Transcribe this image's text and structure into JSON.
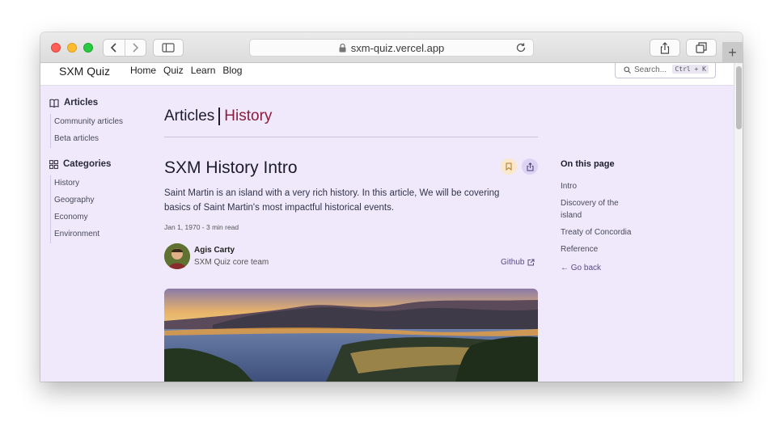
{
  "browser": {
    "url": "sxm-quiz.vercel.app"
  },
  "site": {
    "brand": "SXM Quiz",
    "nav": [
      "Home",
      "Quiz",
      "Learn",
      "Blog"
    ],
    "search": {
      "placeholder": "Search...",
      "shortcut": "Ctrl + K"
    }
  },
  "sidebar": {
    "articles_heading": "Articles",
    "articles_items": [
      "Community articles",
      "Beta articles"
    ],
    "categories_heading": "Categories",
    "categories_items": [
      "History",
      "Geography",
      "Economy",
      "Environment"
    ]
  },
  "breadcrumb": {
    "section": "Articles",
    "category": "History"
  },
  "article": {
    "title": "SXM History Intro",
    "intro": "Saint Martin is an island with a very rich history. In this article, We will be covering basics of Saint Martin's most impactful historical events.",
    "meta": "Jan 1, 1970 - 3 min read",
    "author_name": "Agis Carty",
    "author_role": "SXM Quiz core team",
    "github_link": "Github"
  },
  "toc": {
    "title": "On this page",
    "items": [
      "Intro",
      "Discovery of the island",
      "Treaty of Concordia",
      "Reference"
    ],
    "back": "← Go back"
  },
  "colors": {
    "page_bg": "#efe9fb",
    "accent_category": "#8d1c3c",
    "bookmark_bg": "#fbe7c9",
    "share_bg": "#dcd3f3"
  },
  "icons": {
    "nav_back": "chevron-left-icon",
    "nav_forward": "chevron-right-icon",
    "sidebar": "sidebar-icon",
    "lock": "lock-icon",
    "reload": "reload-icon",
    "share": "share-icon",
    "tabs": "tabs-icon",
    "articles": "book-icon",
    "categories": "grid-icon",
    "bookmark": "bookmark-icon",
    "external": "external-link-icon"
  }
}
